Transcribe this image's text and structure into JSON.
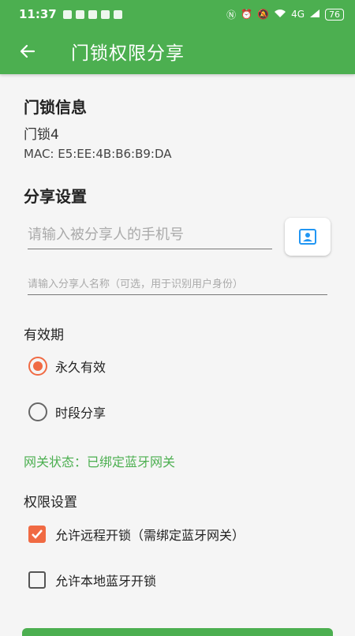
{
  "status_bar": {
    "time": "11:37",
    "network": "4G",
    "battery": "76"
  },
  "app_bar": {
    "title": "门锁权限分享"
  },
  "lock_info": {
    "heading": "门锁信息",
    "name": "门锁4",
    "mac": "MAC: E5:EE:4B:B6:B9:DA"
  },
  "share_settings": {
    "heading": "分享设置",
    "phone_placeholder": "请输入被分享人的手机号",
    "name_placeholder": "请输入分享人名称（可选，用于识别用户身份）"
  },
  "validity": {
    "heading": "有效期",
    "options": [
      {
        "label": "永久有效",
        "selected": true
      },
      {
        "label": "时段分享",
        "selected": false
      }
    ]
  },
  "gateway_status": "网关状态：已绑定蓝牙网关",
  "permissions": {
    "heading": "权限设置",
    "options": [
      {
        "label": "允许远程开锁（需绑定蓝牙网关）",
        "checked": true
      },
      {
        "label": "允许本地蓝牙开锁",
        "checked": false
      }
    ]
  },
  "colors": {
    "primary": "#4caf50",
    "accent": "#f06a43"
  }
}
